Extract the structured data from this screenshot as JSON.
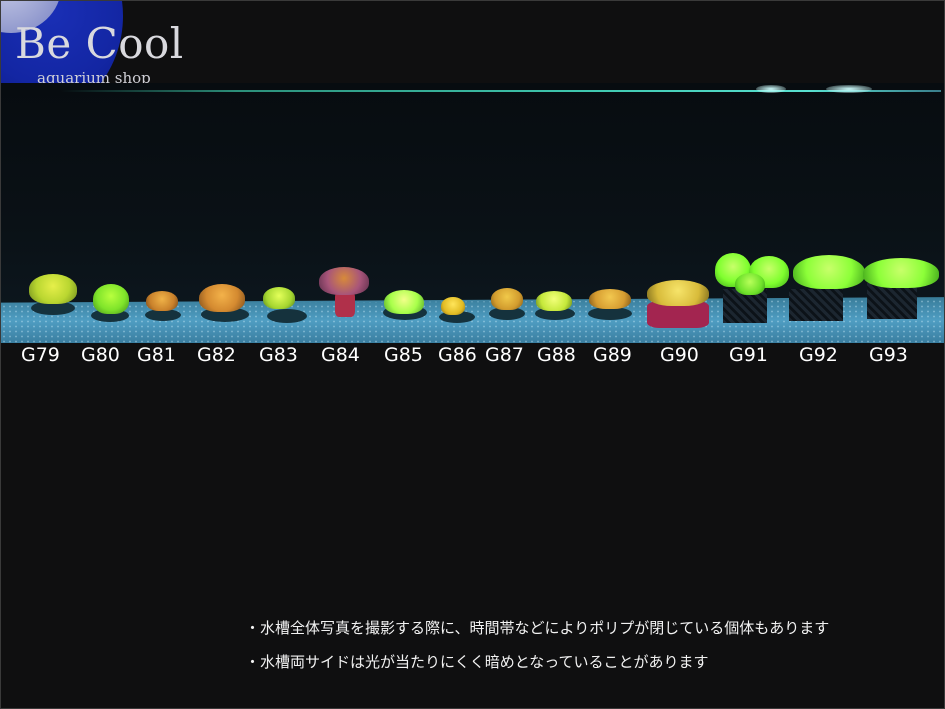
{
  "brand": {
    "name": "Be Cool",
    "tagline": "aquarium shop"
  },
  "labels": [
    "G79",
    "G80",
    "G81",
    "G82",
    "G83",
    "G84",
    "G85",
    "G86",
    "G87",
    "G88",
    "G89",
    "G90",
    "G91",
    "G92",
    "G93"
  ],
  "notes": [
    "・水槽全体写真を撮影する際に、時間帯などによりポリプが閉じている個体もあります",
    "・水槽両サイドは光が当たりにくく暗めとなっていることがあります"
  ],
  "colors": {
    "background": "#0f0f10",
    "logo_blue": "#1326a3",
    "sand": "#4f9dc2",
    "label_text": "#ffffff",
    "coral_lime": "#7dff3a",
    "coral_orange": "#e0a23a",
    "coral_yellow": "#e8e23a"
  }
}
